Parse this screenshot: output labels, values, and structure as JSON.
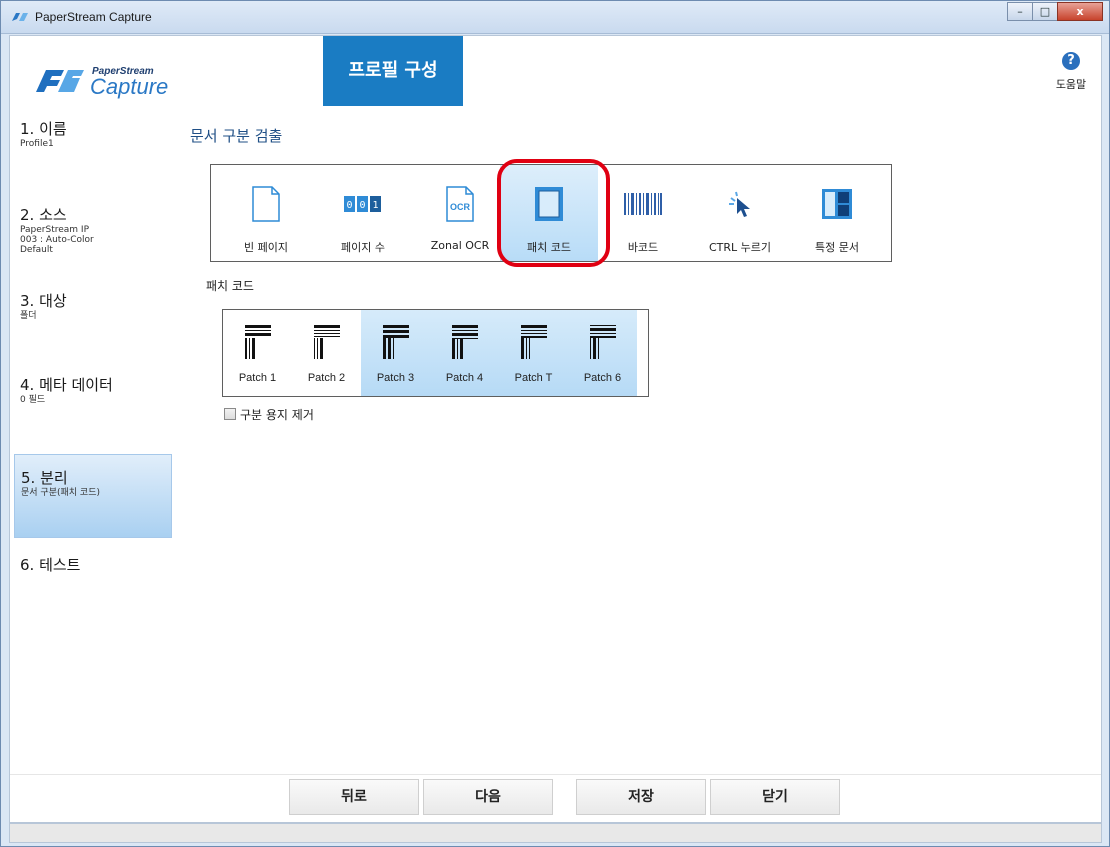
{
  "window": {
    "title": "PaperStream Capture",
    "controls": {
      "minimize": "–",
      "maximize": "□",
      "close": "x"
    }
  },
  "header": {
    "logo_top": "PaperStream",
    "logo_main": "Capture",
    "active_tab": "프로필 구성",
    "help_label": "도움말",
    "help_icon": "?"
  },
  "sidebar": {
    "steps": [
      {
        "title": "1. 이름",
        "sub": "Profile1"
      },
      {
        "title": "2. 소스",
        "sub": "PaperStream IP\n003 : Auto-Color\nDefault"
      },
      {
        "title": "3. 대상",
        "sub": "폴더"
      },
      {
        "title": "4. 메타 데이터",
        "sub": "0 필드"
      },
      {
        "title": "5. 분리",
        "sub": "문서 구분(패치 코드)"
      },
      {
        "title": "6. 테스트",
        "sub": ""
      }
    ],
    "active_step": 4
  },
  "main": {
    "section_title": "문서 구분 검출",
    "separation_types": [
      {
        "label": "빈 페이지",
        "icon": "blank-page-icon"
      },
      {
        "label": "페이지 수",
        "icon": "page-count-icon"
      },
      {
        "label": "Zonal OCR",
        "icon": "zonal-ocr-icon"
      },
      {
        "label": "패치 코드",
        "icon": "patch-code-icon"
      },
      {
        "label": "바코드",
        "icon": "barcode-icon"
      },
      {
        "label": "CTRL 누르기",
        "icon": "ctrl-press-icon"
      },
      {
        "label": "특정 문서",
        "icon": "specific-document-icon"
      }
    ],
    "selected_type": "패치 코드",
    "patch_section_label": "패치 코드",
    "patch_codes": [
      {
        "label": "Patch 1",
        "selected": false
      },
      {
        "label": "Patch 2",
        "selected": false
      },
      {
        "label": "Patch 3",
        "selected": true
      },
      {
        "label": "Patch 4",
        "selected": true
      },
      {
        "label": "Patch T",
        "selected": true
      },
      {
        "label": "Patch 6",
        "selected": true
      }
    ],
    "remove_separator_label": "구분 용지 제거",
    "remove_separator_checked": false
  },
  "footer": {
    "back": "뒤로",
    "next": "다음",
    "save": "저장",
    "close": "닫기"
  },
  "colors": {
    "accent": "#1a7cc3",
    "highlight_ring": "#e00012",
    "selection": "#b8dcf7"
  }
}
